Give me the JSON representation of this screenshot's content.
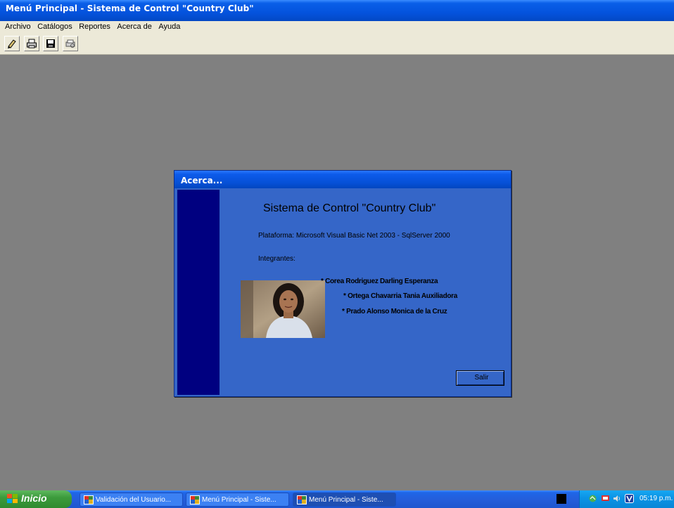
{
  "window": {
    "title": "Menú Principal - Sistema de Control \"Country Club\""
  },
  "menu": {
    "items": [
      "Archivo",
      "Catálogos",
      "Reportes",
      "Acerca de",
      "Ayuda"
    ]
  },
  "toolbar": {
    "icons": [
      "edit-icon",
      "printer-icon",
      "save-icon",
      "print-preview-icon"
    ]
  },
  "dialog": {
    "title": "Acerca...",
    "heading": "Sistema de Control \"Country Club\"",
    "platform": "Plataforma: Microsoft Visual Basic Net 2003 - SqlServer 2000",
    "members_label": "Integrantes:",
    "members": [
      "* Corea Rodriguez Darling Esperanza",
      "* Ortega Chavarria Tania Auxiliadora",
      "* Prado Alonso Monica de la Cruz"
    ],
    "exit_label": "Salir"
  },
  "taskbar": {
    "start_label": "Inicio",
    "tasks": [
      "Validación del Usuario...",
      "Menú Principal - Siste...",
      "Menú Principal - Siste..."
    ],
    "time": "05:19 p.m."
  },
  "colors": {
    "dialog_bg": "#3566c8",
    "sidebar": "#000080",
    "title_blue": "#0453dd",
    "desktop": "#808080"
  }
}
